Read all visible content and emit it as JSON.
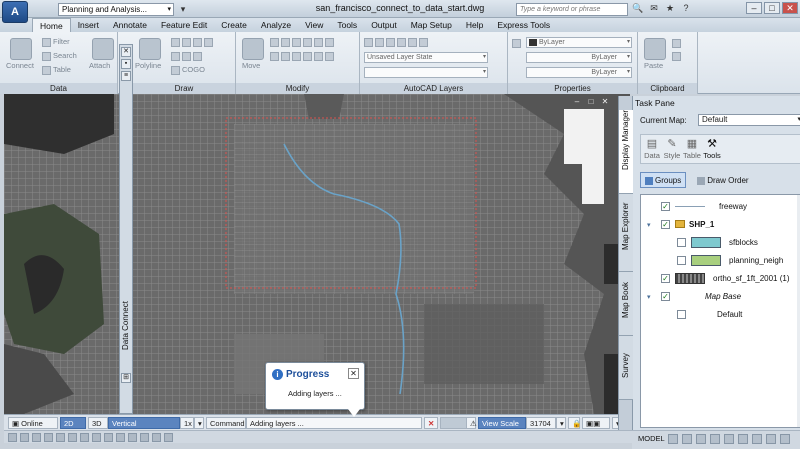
{
  "app": {
    "icon_letter": "A",
    "workspace": "Planning and Analysis...",
    "document_title": "san_francisco_connect_to_data_start.dwg",
    "search_placeholder": "Type a keyword or phrase",
    "win_controls": [
      "–",
      "□",
      "✕"
    ]
  },
  "tabs": [
    "Home",
    "Insert",
    "Annotate",
    "Feature Edit",
    "Create",
    "Analyze",
    "View",
    "Tools",
    "Output",
    "Map Setup",
    "Help",
    "Express Tools"
  ],
  "active_tab": "Home",
  "ribbon": {
    "data_panel": {
      "label": "Data",
      "buttons": [
        "Connect",
        "Filter",
        "Search",
        "Table",
        "Attach"
      ]
    },
    "draw_panel": {
      "label": "Draw",
      "buttons": [
        "Polyline",
        "COGO"
      ]
    },
    "modify_panel": {
      "label": "Modify",
      "buttons": [
        "Move"
      ]
    },
    "layers_panel": {
      "label": "AutoCAD Layers",
      "layer_state": "Unsaved Layer State"
    },
    "properties_panel": {
      "label": "Properties",
      "combos": [
        "ByLayer",
        "ByLayer",
        "ByLayer"
      ]
    },
    "clipboard_panel": {
      "label": "Clipboard",
      "buttons": [
        "Paste"
      ]
    }
  },
  "data_connect": {
    "label": "Data Connect"
  },
  "progress": {
    "title": "Progress",
    "message": "Adding layers ..."
  },
  "statusbar": {
    "online": "Online",
    "view2d": "2D",
    "view3d": "3D",
    "vertical_exaggeration": "Vertical Exaggeration:",
    "vertical_exaggeration_value": "1x",
    "command_label": "Command",
    "command_text": "Adding layers ...",
    "view_scale_label": "View Scale",
    "view_scale_prefix": "1 :",
    "view_scale_value": "31704",
    "model": "MODEL"
  },
  "task_pane": {
    "title": "Task Pane",
    "vertical_tabs": [
      "Display Manager",
      "Map Explorer",
      "Map Book",
      "Survey"
    ],
    "current_map_label": "Current Map:",
    "current_map_value": "Default",
    "tools": [
      "Data",
      "Style",
      "Table",
      "Tools"
    ],
    "groups_button": "Groups",
    "draw_order_button": "Draw Order",
    "layers": [
      {
        "name": "freeway",
        "checked": true,
        "swatch": "line"
      },
      {
        "name": "SHP_1",
        "checked": true,
        "folder": true,
        "bold": true
      },
      {
        "name": "sfblocks",
        "checked": false,
        "swatch": "#7ec9cf"
      },
      {
        "name": "planning_neigh",
        "checked": false,
        "swatch": "#a8cf7e"
      },
      {
        "name": "ortho_sf_1ft_2001 (1)",
        "checked": true,
        "swatch": "raster"
      },
      {
        "name": "Map Base",
        "checked": true,
        "italic": true
      },
      {
        "name": "Default",
        "checked": false
      }
    ]
  },
  "colors": {
    "accent": "#2f6fc4",
    "selection_rect": "#d9534f",
    "river": "#6aa3c8"
  }
}
